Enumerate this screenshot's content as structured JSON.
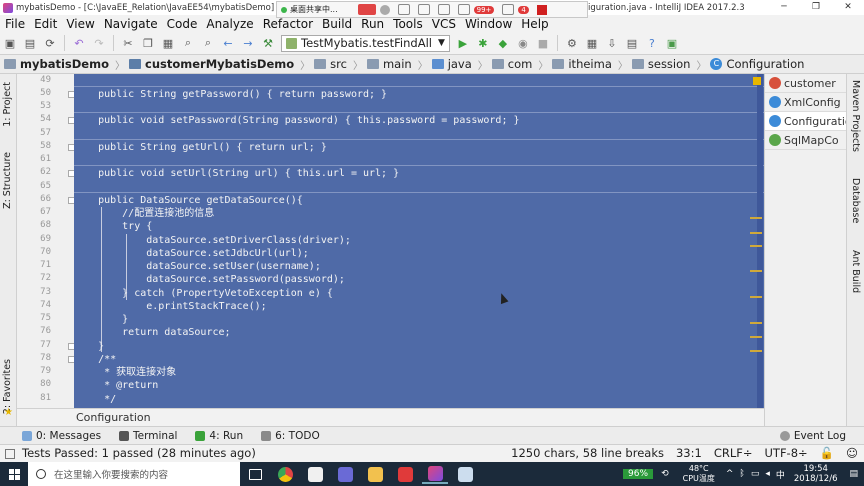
{
  "window": {
    "title_left": "mybatisDemo - [C:\\JavaEE_Relation\\JavaEE54\\mybatisDemo] - [custom",
    "title_right": "iguration.java - IntelliJ IDEA 2017.2.3",
    "minimize": "─",
    "restore": "❐",
    "close": "✕"
  },
  "share_bar": {
    "label": "桌面共享中...",
    "badge_a": "99+",
    "badge_b": "4"
  },
  "menu": [
    "File",
    "Edit",
    "View",
    "Navigate",
    "Code",
    "Analyze",
    "Refactor",
    "Build",
    "Run",
    "Tools",
    "VCS",
    "Window",
    "Help"
  ],
  "toolbar": {
    "run_config": "TestMybatis.testFindAll"
  },
  "breadcrumb": [
    "mybatisDemo",
    "customerMybatisDemo",
    "src",
    "main",
    "java",
    "com",
    "itheima",
    "session",
    "Configuration"
  ],
  "left_tabs": {
    "project": "1: Project",
    "structure": "Z: Structure",
    "favorites": "2: Favorites"
  },
  "right_tabs": [
    "customer",
    "XmlConfig",
    "Configuration",
    "SqlMapCo"
  ],
  "right_strip": {
    "maven": "Maven Projects",
    "database": "Database",
    "ant": "Ant Build"
  },
  "gutter_numbers": [
    "49",
    "50",
    "53",
    "54",
    "57",
    "58",
    "61",
    "62",
    "65",
    "66",
    "67",
    "68",
    "69",
    "70",
    "71",
    "72",
    "73",
    "74",
    "75",
    "76",
    "77",
    "78",
    "79",
    "80",
    "81"
  ],
  "code": [
    "",
    "    public String getPassword() { return password; }",
    "",
    "    public void setPassword(String password) { this.password = password; }",
    "",
    "    public String getUrl() { return url; }",
    "",
    "    public void setUrl(String url) { this.url = url; }",
    "",
    "    public DataSource getDataSource(){",
    "        //配置连接池的信息",
    "        try {",
    "            dataSource.setDriverClass(driver);",
    "            dataSource.setJdbcUrl(url);",
    "            dataSource.setUser(username);",
    "            dataSource.setPassword(password);",
    "        } catch (PropertyVetoException e) {",
    "            e.printStackTrace();",
    "        }",
    "        return dataSource;",
    "    }",
    "    /**",
    "     * 获取连接对象",
    "     * @return",
    "     */"
  ],
  "editor_footer": "Configuration",
  "bottom_tabs": {
    "messages": "0: Messages",
    "terminal": "Terminal",
    "run": "4: Run",
    "todo": "6: TODO",
    "event_log": "Event Log"
  },
  "status": {
    "message": "Tests Passed: 1 passed (28 minutes ago)",
    "chars": "1250 chars, 58 line breaks",
    "position": "33:1",
    "line_sep": "CRLF÷",
    "encoding": "UTF-8÷"
  },
  "taskbar": {
    "search_placeholder": "在这里输入你要搜索的内容",
    "battery": "96%",
    "temp": "48°C",
    "temp_label": "CPU温度",
    "time": "19:54",
    "date": "2018/12/6"
  },
  "colors": {
    "editor_selection": "#4f6aa7",
    "taskbar": "#1b2a3a"
  }
}
